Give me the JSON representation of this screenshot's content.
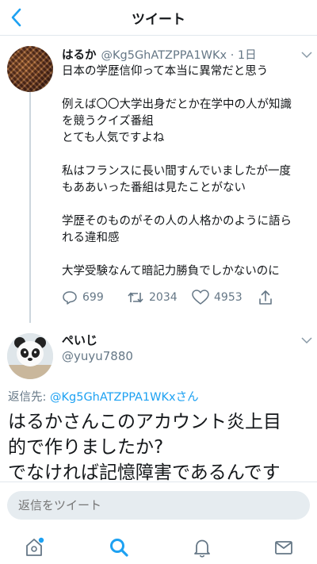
{
  "nav": {
    "title": "ツイート"
  },
  "tweet": {
    "name": "はるか",
    "handle_time": "@Kg5GhATZPPA1WKx · 1日",
    "paragraphs": [
      [
        "日本の学歴信仰って本当に異常だと思う"
      ],
      [
        "例えば〇〇大学出身だとか在学中の人が知識",
        "を競うクイズ番組",
        "とても人気ですよね"
      ],
      [
        "私はフランスに長い間すんでいましたが一度",
        "もああいった番組は見たことがない"
      ],
      [
        "学歴そのものがその人の人格かのように語ら",
        "れる違和感"
      ],
      [
        "大学受験なんて暗記力勝負でしかないのに"
      ]
    ],
    "reply_count": "699",
    "retweet_count": "2034",
    "like_count": "4953"
  },
  "reply": {
    "name": "ぺいじ",
    "handle": "@yuyu7880",
    "reply_prefix": "返信先: ",
    "reply_target": "@Kg5GhATZPPA1WKxさん",
    "lines": [
      "はるかさんこのアカウント炎上目",
      "的で作りましたか?",
      "でなければ記憶障害であるんです"
    ]
  },
  "compose": {
    "placeholder": "返信をツイート"
  },
  "icons": {
    "back": "chevron-left-icon",
    "more": "chevron-down-icon",
    "reply": "reply-icon",
    "retweet": "retweet-icon",
    "like": "heart-icon",
    "share": "share-icon",
    "home": "home-icon",
    "search": "search-icon",
    "notifications": "bell-icon",
    "messages": "mail-icon"
  },
  "colors": {
    "accent": "#1da1f2",
    "secondary_text": "#657786",
    "divider": "#e1e8ed"
  }
}
